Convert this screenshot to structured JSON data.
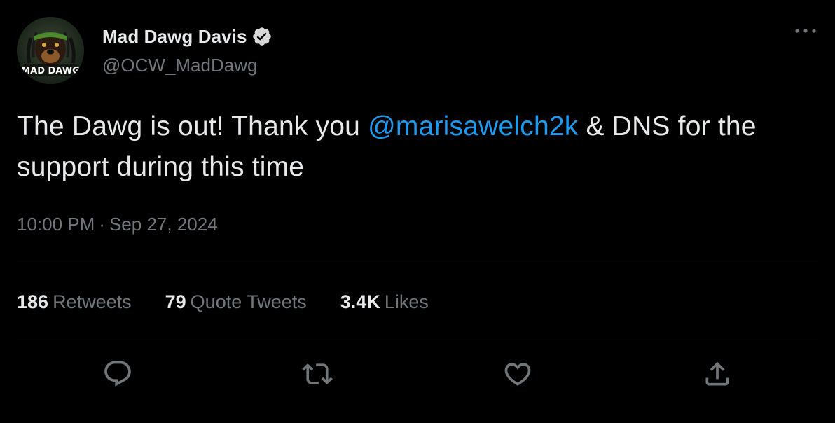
{
  "author": {
    "display_name": "Mad Dawg Davis",
    "handle": "@OCW_MadDawg",
    "avatar_text": "MAD DAWG",
    "verified": true
  },
  "tweet": {
    "text_before": "The Dawg is out! Thank you ",
    "mention": "@marisawelch2k",
    "text_after": " & DNS for the support during this time"
  },
  "timestamp": {
    "time": "10:00 PM",
    "separator": "·",
    "date": "Sep 27, 2024"
  },
  "stats": {
    "retweets_count": "186",
    "retweets_label": "Retweets",
    "quotes_count": "79",
    "quotes_label": "Quote Tweets",
    "likes_count": "3.4K",
    "likes_label": "Likes"
  },
  "actions": {
    "reply_icon": "reply-icon",
    "retweet_icon": "retweet-icon",
    "like_icon": "heart-icon",
    "share_icon": "share-icon"
  },
  "colors": {
    "background": "#000000",
    "text": "#e7e9ea",
    "secondary": "#71767b",
    "accent": "#1d9bf0",
    "divider": "#2f3336"
  }
}
